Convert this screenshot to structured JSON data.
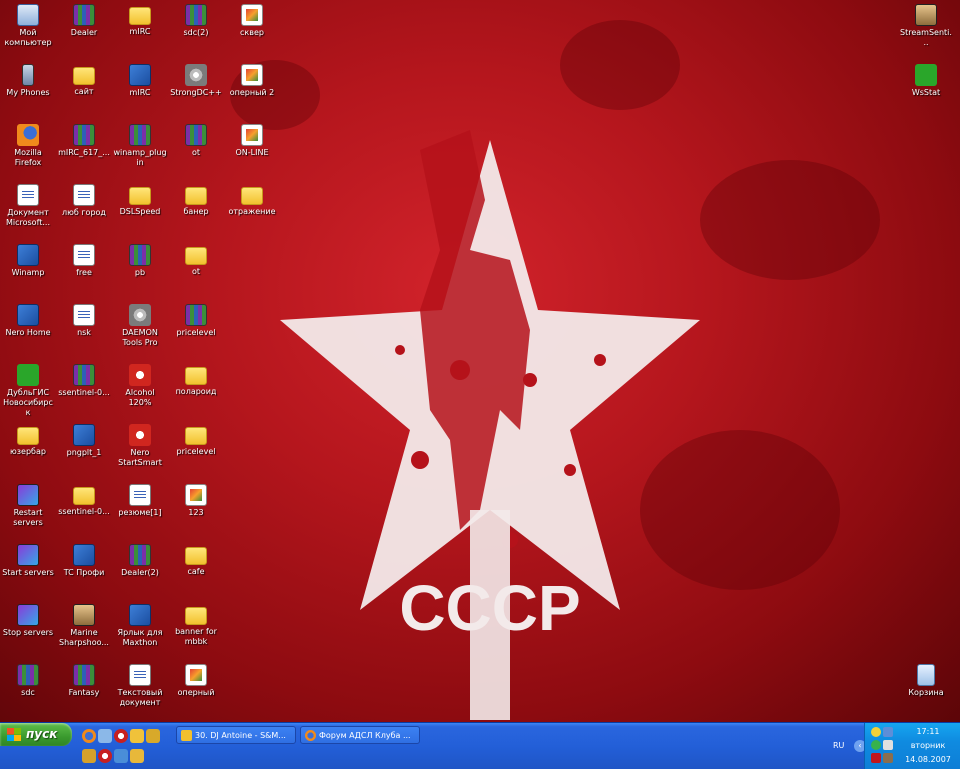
{
  "desktop": {
    "wallpaper_text": "СССР",
    "icons": [
      {
        "label": "Мой компьютер",
        "type": "pc"
      },
      {
        "label": "My Phones",
        "type": "phone"
      },
      {
        "label": "Mozilla Firefox",
        "type": "ff"
      },
      {
        "label": "Документ Microsoft...",
        "type": "doc"
      },
      {
        "label": "Winamp",
        "type": "exe"
      },
      {
        "label": "Nero Home",
        "type": "exe"
      },
      {
        "label": "ДубльГИС Новосибирск",
        "type": "green"
      },
      {
        "label": "юзербар",
        "type": "folder"
      },
      {
        "label": "Restart servers",
        "type": "star"
      },
      {
        "label": "Start servers",
        "type": "star"
      },
      {
        "label": "Stop servers",
        "type": "star"
      },
      {
        "label": "sdc",
        "type": "rar"
      },
      {
        "label": "Dealer",
        "type": "rar"
      },
      {
        "label": "сайт",
        "type": "folder"
      },
      {
        "label": "mIRC_617_...",
        "type": "rar"
      },
      {
        "label": "люб город",
        "type": "doc"
      },
      {
        "label": "free",
        "type": "doc"
      },
      {
        "label": "nsk",
        "type": "doc"
      },
      {
        "label": "ssentinel-0...",
        "type": "rar"
      },
      {
        "label": "pngplt_1",
        "type": "exe"
      },
      {
        "label": "ssentinel-0...",
        "type": "folder"
      },
      {
        "label": "TC Профи",
        "type": "exe"
      },
      {
        "label": "Marine Sharpshoo...",
        "type": "face"
      },
      {
        "label": "Fantasy",
        "type": "rar"
      },
      {
        "label": "mIRC",
        "type": "folder"
      },
      {
        "label": "mIRC",
        "type": "exe"
      },
      {
        "label": "winamp_plugin",
        "type": "rar"
      },
      {
        "label": "DSLSpeed",
        "type": "folder"
      },
      {
        "label": "pb",
        "type": "rar"
      },
      {
        "label": "DAEMON Tools Pro",
        "type": "disc"
      },
      {
        "label": "Alcohol 120%",
        "type": "red"
      },
      {
        "label": "Nero StartSmart",
        "type": "red"
      },
      {
        "label": "резюме[1]",
        "type": "doc"
      },
      {
        "label": "Dealer(2)",
        "type": "rar"
      },
      {
        "label": "Ярлык для Maxthon",
        "type": "exe"
      },
      {
        "label": "Текстовый документ",
        "type": "doc"
      },
      {
        "label": "sdc(2)",
        "type": "rar"
      },
      {
        "label": "StrongDC++",
        "type": "disc"
      },
      {
        "label": "ot",
        "type": "rar"
      },
      {
        "label": "банер",
        "type": "folder"
      },
      {
        "label": "ot",
        "type": "folder"
      },
      {
        "label": "pricelevel",
        "type": "rar"
      },
      {
        "label": "полароид",
        "type": "folder"
      },
      {
        "label": "pricelevel",
        "type": "folder"
      },
      {
        "label": "123",
        "type": "img"
      },
      {
        "label": "cafe",
        "type": "folder"
      },
      {
        "label": "banner for mbbk",
        "type": "folder"
      },
      {
        "label": "оперный",
        "type": "img"
      },
      {
        "label": "сквер",
        "type": "img"
      },
      {
        "label": "оперный 2",
        "type": "img"
      },
      {
        "label": "ON-LINE",
        "type": "img"
      },
      {
        "label": "отражение",
        "type": "folder"
      },
      {
        "label": "StreamSenti...",
        "type": "face"
      },
      {
        "label": "WsStat",
        "type": "green"
      },
      {
        "label": "Корзина",
        "type": "bin"
      }
    ]
  },
  "taskbar": {
    "start_label": "пуск",
    "tasks": [
      {
        "label": "30. DJ Antoine - S&M..."
      },
      {
        "label": "Форум АДСЛ Клуба ..."
      }
    ],
    "language": "RU",
    "clock": {
      "time": "17:11",
      "day": "вторник",
      "date": "14.08.2007"
    }
  }
}
